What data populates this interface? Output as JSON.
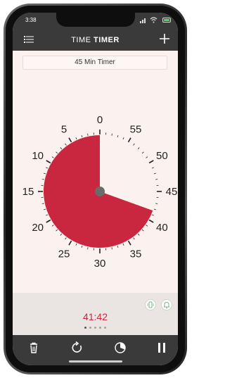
{
  "status_bar": {
    "time": "3:38"
  },
  "app": {
    "title_part1": "TIME",
    "title_part2": "TIMER"
  },
  "timer": {
    "name": "45 Min Timer",
    "remaining_display": "41:42",
    "remaining_minutes": 41.7,
    "dial_labels": [
      "0",
      "5",
      "10",
      "15",
      "20",
      "25",
      "30",
      "35",
      "40",
      "45",
      "50",
      "55"
    ],
    "disk_color": "#c8273f"
  },
  "pager": {
    "total": 5,
    "active_index": 0
  },
  "icons": {
    "menu": "menu-icon",
    "add": "plus-icon",
    "vibrate": "vibrate-icon",
    "alarm": "bell-icon",
    "delete": "trash-icon",
    "reset": "reset-icon",
    "settings": "dial-settings-icon",
    "pause": "pause-icon"
  }
}
